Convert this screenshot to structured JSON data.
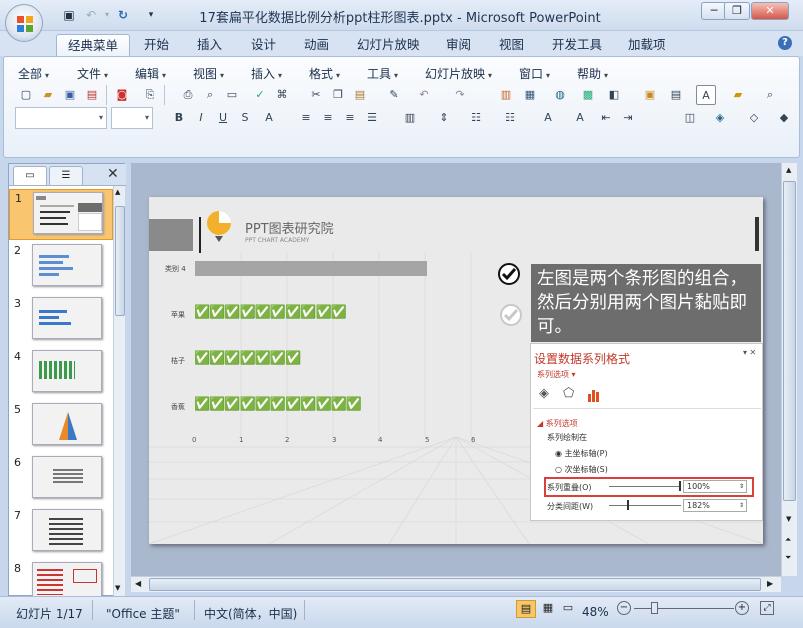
{
  "window": {
    "title": "17套扁平化数据比例分析ppt柱形图表.pptx - Microsoft PowerPoint"
  },
  "ribbon_tabs": [
    "经典菜单",
    "开始",
    "插入",
    "设计",
    "动画",
    "幻灯片放映",
    "审阅",
    "视图",
    "开发工具",
    "加载项"
  ],
  "menus": [
    "全部",
    "文件",
    "编辑",
    "视图",
    "插入",
    "格式",
    "工具",
    "幻灯片放映",
    "窗口",
    "帮助"
  ],
  "thumbnails": [
    "1",
    "2",
    "3",
    "4",
    "5",
    "6",
    "7",
    "8"
  ],
  "slide": {
    "brand_name": "PPT图表研究院",
    "brand_sub": "PPT CHART ACADEMY",
    "categories": [
      "类别 4",
      "苹果",
      "桔子",
      "香蕉"
    ],
    "axis_ticks": [
      "0",
      "1",
      "2",
      "3",
      "4",
      "5",
      "6"
    ],
    "callout": "左图是两个条形图的组合，然后分别用两个图片黏贴即可。",
    "format_pane": {
      "title": "设置数据系列格式",
      "series_options_dropdown": "系列选项",
      "section": "系列选项",
      "plot_on": "系列绘制在",
      "primary_axis": "主坐标轴(P)",
      "secondary_axis": "次坐标轴(S)",
      "overlap_label": "系列重叠(O)",
      "overlap_value": "100%",
      "gap_label": "分类间距(W)",
      "gap_value": "182%"
    }
  },
  "status": {
    "slide_info": "幻灯片 1/17",
    "theme": "\"Office 主题\"",
    "language": "中文(简体，中国)",
    "zoom": "48%"
  },
  "colors": {
    "accent": "#f0a020",
    "ribbon": "#d7e3f2",
    "callout_bg": "#6d6d6d",
    "highlight_border": "#d9403a"
  }
}
